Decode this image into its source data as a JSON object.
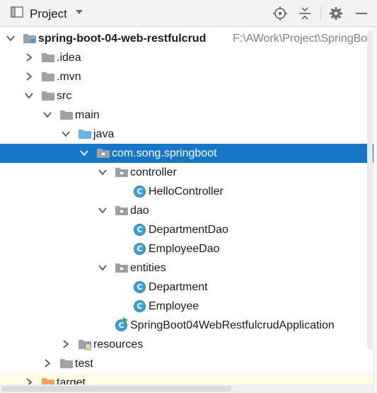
{
  "panel": {
    "title": "Project",
    "icons": [
      "project-view-icon",
      "chevron-down-icon",
      "locate-target-icon",
      "collapse-all-icon",
      "settings-gear-icon",
      "hide-panel-icon"
    ]
  },
  "tree": [
    {
      "label": "spring-boot-04-web-restfulcrud",
      "path": "F:\\AWork\\Project\\SpringBo",
      "bold": true,
      "expanded": true,
      "icon": "module-folder-icon"
    },
    {
      "label": ".idea",
      "expanded": false,
      "icon": "folder-icon"
    },
    {
      "label": ".mvn",
      "expanded": false,
      "icon": "folder-icon"
    },
    {
      "label": "src",
      "expanded": true,
      "icon": "folder-icon"
    },
    {
      "label": "main",
      "expanded": true,
      "icon": "folder-icon"
    },
    {
      "label": "java",
      "expanded": true,
      "icon": "source-root-folder-icon"
    },
    {
      "label": "com.song.springboot",
      "expanded": true,
      "icon": "package-icon",
      "selected": true
    },
    {
      "label": "controller",
      "expanded": true,
      "icon": "package-icon"
    },
    {
      "label": "HelloController",
      "icon": "class-icon",
      "badge": "C"
    },
    {
      "label": "dao",
      "expanded": true,
      "icon": "package-icon"
    },
    {
      "label": "DepartmentDao",
      "icon": "class-icon",
      "badge": "C"
    },
    {
      "label": "EmployeeDao",
      "icon": "class-icon",
      "badge": "C"
    },
    {
      "label": "entities",
      "expanded": true,
      "icon": "package-icon"
    },
    {
      "label": "Department",
      "icon": "class-icon",
      "badge": "C"
    },
    {
      "label": "Employee",
      "icon": "class-icon",
      "badge": "C"
    },
    {
      "label": "SpringBoot04WebRestfulcrudApplication",
      "icon": "spring-boot-app-icon",
      "badge": "C"
    },
    {
      "label": "resources",
      "expanded": false,
      "icon": "resources-folder-icon"
    },
    {
      "label": "test",
      "expanded": false,
      "icon": "folder-icon"
    },
    {
      "label": "target",
      "expanded": false,
      "icon": "excluded-folder-icon",
      "highlighted": true
    }
  ],
  "colors": {
    "selection": "#1876c7",
    "folder": "#9da2a6",
    "source_folder": "#62b5e5",
    "excluded_folder": "#f0a35c",
    "class_badge": "#40a0d0",
    "highlight_row": "#fefbe4"
  }
}
